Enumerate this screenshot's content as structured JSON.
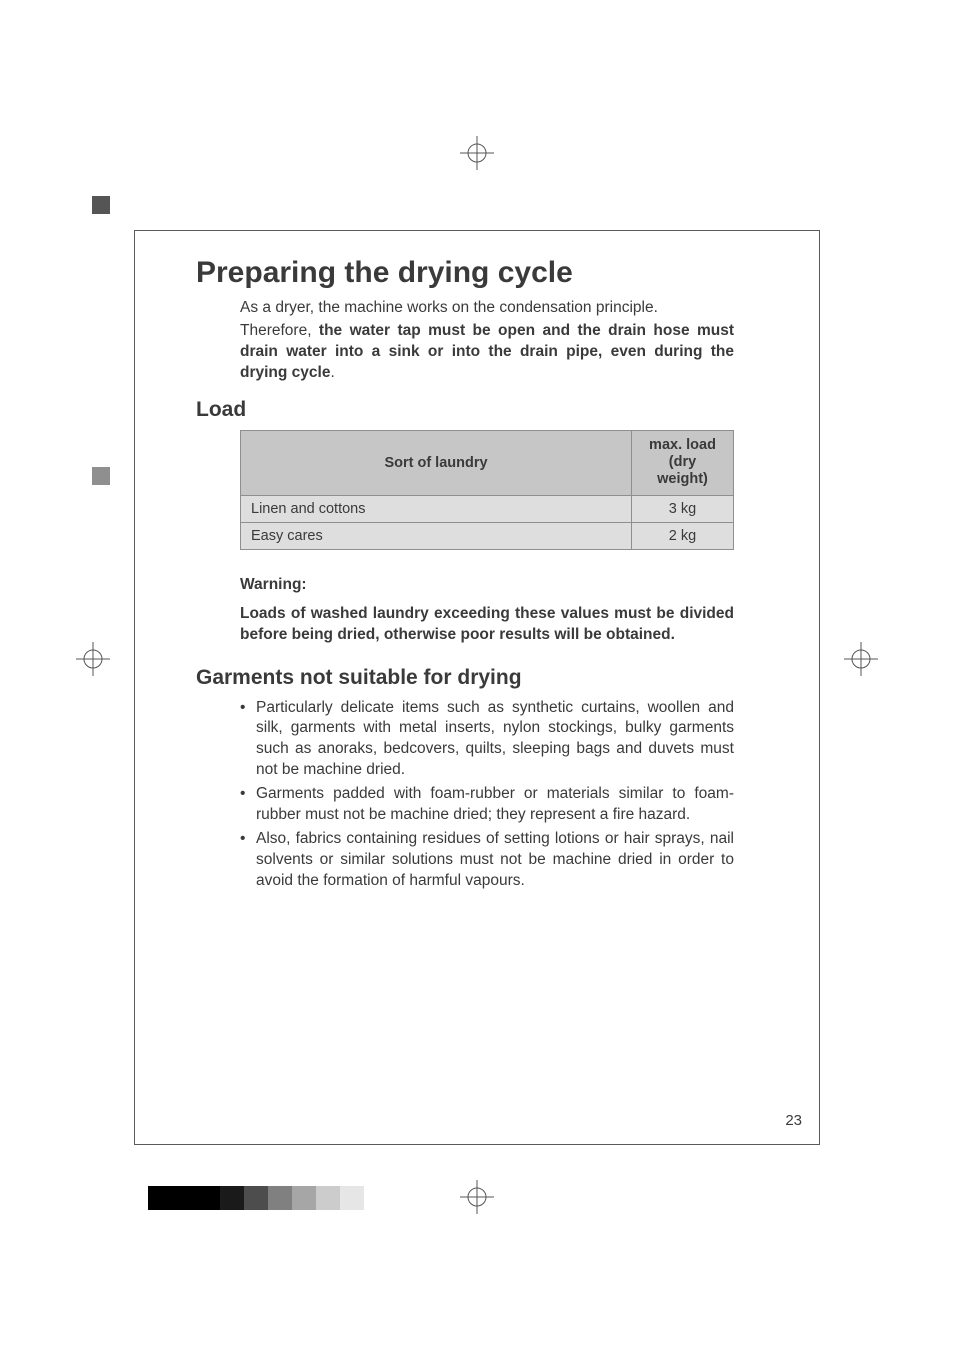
{
  "page_number": "23",
  "heading": "Preparing the drying cycle",
  "intro_line": "As a dryer, the machine works on the condensation principle.",
  "therefore_lead": "Therefore, ",
  "therefore_bold": "the water tap must be open and the drain hose must drain water into a sink or into the drain pipe, even during the drying cycle",
  "therefore_tail": ".",
  "section_load": "Load",
  "table": {
    "col1": "Sort of laundry",
    "col2_l1": "max. load",
    "col2_l2": "(dry weight)",
    "rows": [
      {
        "label": "Linen and cottons",
        "value": "3 kg"
      },
      {
        "label": "Easy cares",
        "value": "2 kg"
      }
    ]
  },
  "warning_label": "Warning:",
  "warning_body": "Loads of washed laundry exceeding these values must be divided before being dried, otherwise poor results will be obtained.",
  "section_garments": "Garments not suitable for drying",
  "bullets": [
    "Particularly delicate items such as synthetic curtains, woollen and silk, garments with metal inserts, nylon stockings, bulky garments such as anoraks, bedcovers, quilts, sleeping bags and duvets must not be machine dried.",
    "Garments padded with foam-rubber or materials similar to foam-rubber must not be machine dried; they represent a fire hazard.",
    "Also, fabrics containing residues of setting lotions or hair sprays, nail solvents or similar solutions must not be machine dried in order to avoid the formation of harmful vapours."
  ],
  "greyscale": [
    "#000000",
    "#000000",
    "#000000",
    "#1a1a1a",
    "#4d4d4d",
    "#808080",
    "#a6a6a6",
    "#cccccc",
    "#e6e6e6"
  ]
}
